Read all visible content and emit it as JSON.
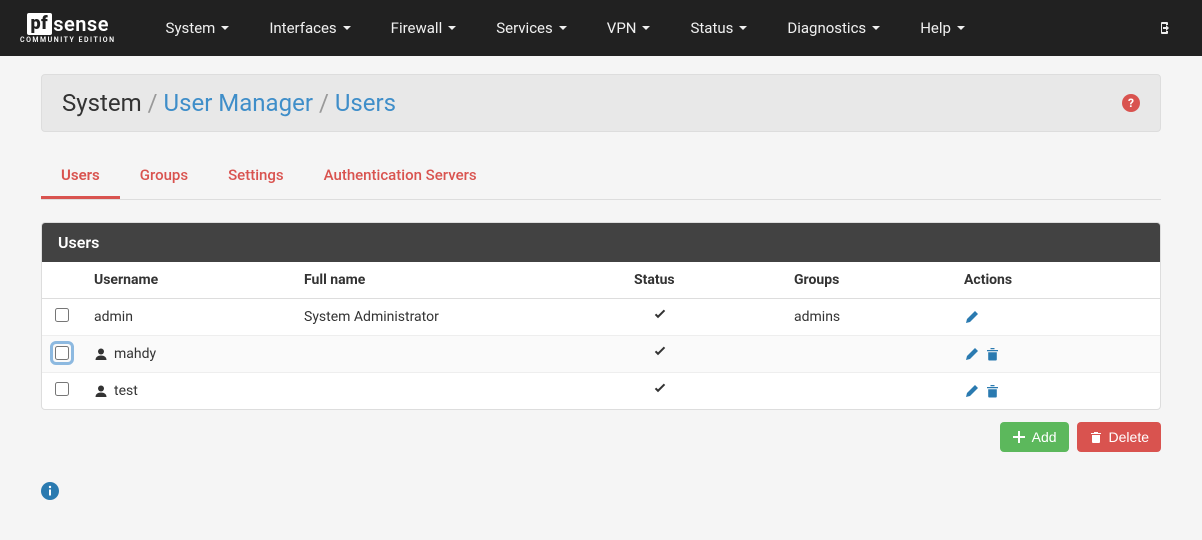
{
  "logo": {
    "box": "pf",
    "text": "sense",
    "sub": "COMMUNITY EDITION"
  },
  "nav": [
    "System",
    "Interfaces",
    "Firewall",
    "Services",
    "VPN",
    "Status",
    "Diagnostics",
    "Help"
  ],
  "breadcrumb": {
    "root": "System",
    "mid": "User Manager",
    "leaf": "Users"
  },
  "tabs": [
    "Users",
    "Groups",
    "Settings",
    "Authentication Servers"
  ],
  "panel_title": "Users",
  "columns": {
    "username": "Username",
    "fullname": "Full name",
    "status": "Status",
    "groups": "Groups",
    "actions": "Actions"
  },
  "rows": [
    {
      "username": "admin",
      "fullname": "System Administrator",
      "groups": "admins",
      "checked": false,
      "show_user_icon": false,
      "can_delete": false,
      "focused": false
    },
    {
      "username": "mahdy",
      "fullname": "",
      "groups": "",
      "checked": false,
      "show_user_icon": true,
      "can_delete": true,
      "focused": true
    },
    {
      "username": "test",
      "fullname": "",
      "groups": "",
      "checked": false,
      "show_user_icon": true,
      "can_delete": true,
      "focused": false
    }
  ],
  "buttons": {
    "add": "Add",
    "delete": "Delete"
  }
}
